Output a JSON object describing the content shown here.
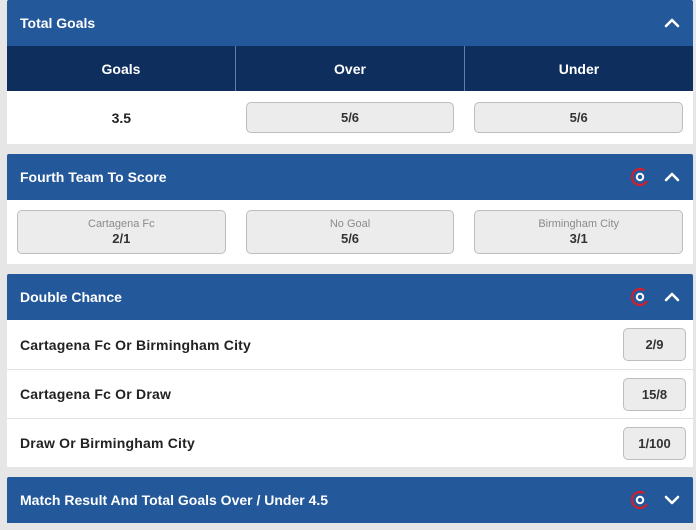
{
  "total_goals": {
    "title": "Total Goals",
    "columns": [
      "Goals",
      "Over",
      "Under"
    ],
    "row": {
      "goals": "3.5",
      "over": "5/6",
      "under": "5/6"
    }
  },
  "fourth_team": {
    "title": "Fourth Team To Score",
    "selections": [
      {
        "name": "Cartagena Fc",
        "odds": "2/1"
      },
      {
        "name": "No Goal",
        "odds": "5/6"
      },
      {
        "name": "Birmingham City",
        "odds": "3/1"
      }
    ]
  },
  "double_chance": {
    "title": "Double Chance",
    "rows": [
      {
        "label": "Cartagena Fc Or Birmingham City",
        "odds": "2/9"
      },
      {
        "label": "Cartagena Fc Or Draw",
        "odds": "15/8"
      },
      {
        "label": "Draw Or Birmingham City",
        "odds": "1/100"
      }
    ]
  },
  "match_result": {
    "title": "Match Result And Total Goals Over / Under 4.5"
  },
  "icons": {
    "cashout": "cashout-icon",
    "collapse": "chevron-up-icon",
    "expand": "chevron-down-icon"
  },
  "colors": {
    "header_bg": "#23589a",
    "column_header_bg": "#0e2f5e",
    "cashout_red": "#d0202e"
  }
}
